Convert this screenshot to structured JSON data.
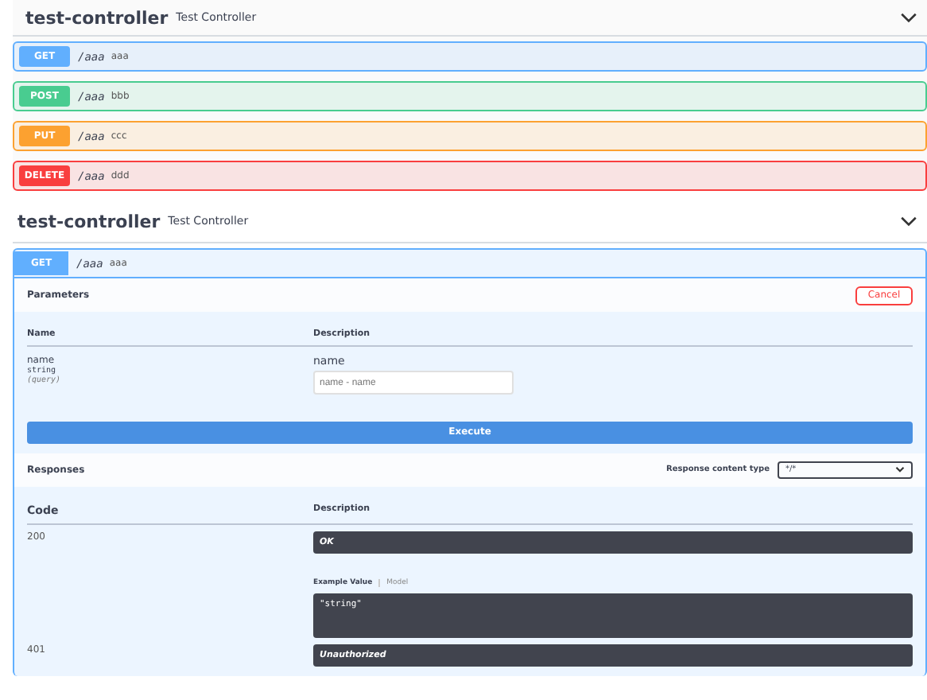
{
  "sections": [
    {
      "name": "test-controller",
      "description": "Test Controller",
      "operations": [
        {
          "method": "GET",
          "path": "/aaa",
          "summary": "aaa",
          "color": "#61affe",
          "expanded": false
        },
        {
          "method": "POST",
          "path": "/aaa",
          "summary": "bbb",
          "color": "#49cc90",
          "expanded": false
        },
        {
          "method": "PUT",
          "path": "/aaa",
          "summary": "ccc",
          "color": "#fca130",
          "expanded": false
        },
        {
          "method": "DELETE",
          "path": "/aaa",
          "summary": "ddd",
          "color": "#f93e3e",
          "expanded": false
        }
      ]
    },
    {
      "name": "test-controller",
      "description": "Test Controller",
      "operations": [
        {
          "method": "GET",
          "path": "/aaa",
          "summary": "aaa",
          "color": "#61affe",
          "expanded": true
        }
      ]
    }
  ],
  "detail": {
    "parameters_title": "Parameters",
    "cancel": "Cancel",
    "param_columns": [
      "Name",
      "Description"
    ],
    "param": {
      "name": "name",
      "type": "string",
      "location": "(query)",
      "description": "name",
      "placeholder": "name - name"
    },
    "execute": "Execute",
    "responses_title": "Responses",
    "content_type_label": "Response content type",
    "content_type": "*/*",
    "response_columns": [
      "Code",
      "Description"
    ],
    "responses": [
      {
        "code": "200",
        "description": "OK",
        "example_tabs": [
          {
            "label": "Example Value",
            "selected": true
          },
          {
            "label": "Model",
            "selected": false
          }
        ],
        "example": "\"string\""
      },
      {
        "code": "401",
        "description": "Unauthorized"
      }
    ]
  }
}
